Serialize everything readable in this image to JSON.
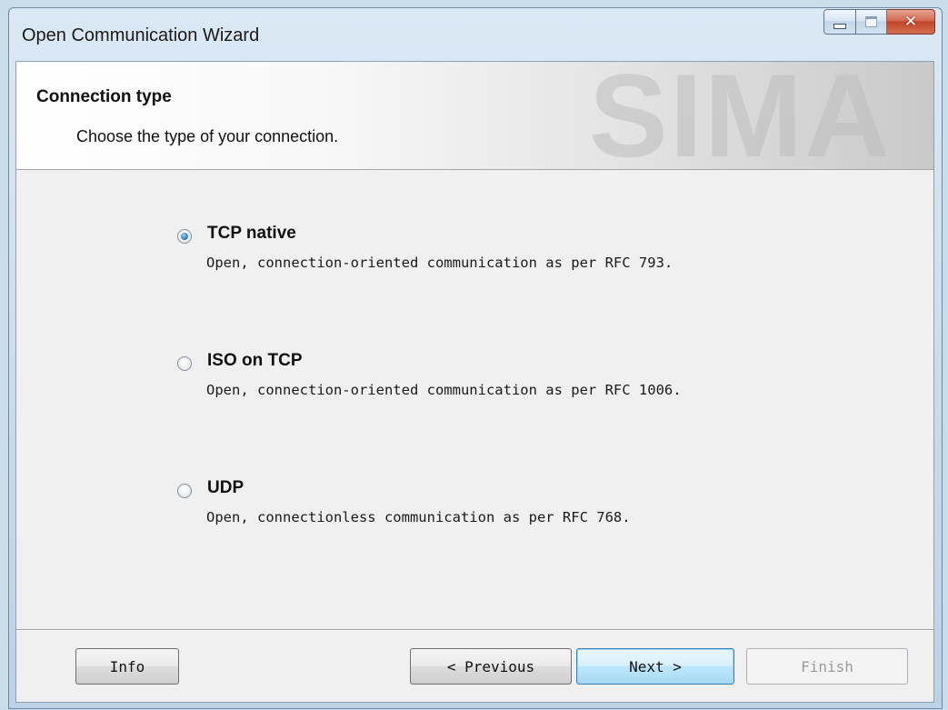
{
  "window": {
    "title": "Open Communication Wizard"
  },
  "header": {
    "title": "Connection type",
    "subtitle": "Choose the type of your connection.",
    "watermark": "SIMA"
  },
  "options": [
    {
      "label": "TCP native",
      "description": "Open, connection-oriented communication as per RFC 793.",
      "selected": true
    },
    {
      "label": "ISO on TCP",
      "description": "Open, connection-oriented communication as per RFC 1006.",
      "selected": false
    },
    {
      "label": "UDP",
      "description": "Open, connectionless communication as per RFC 768.",
      "selected": false
    }
  ],
  "buttons": {
    "info": "Info",
    "previous": "< Previous",
    "next": "Next >",
    "finish": "Finish"
  },
  "colors": {
    "close_button": "#c1442a",
    "default_button_border": "#3c7fb1",
    "disabled_text": "#9a9a9a"
  },
  "icons": {
    "minimize": "minimize-icon",
    "maximize": "maximize-icon",
    "close": "close-icon"
  }
}
